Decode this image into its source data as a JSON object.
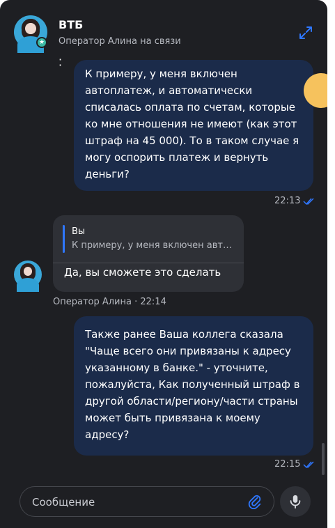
{
  "header": {
    "title": "ВТБ",
    "subtitle": "Оператор Алина на связи",
    "expand_icon": "expand-arrows-icon"
  },
  "messages": [
    {
      "type": "outgoing",
      "text": "К примеру, у меня включен автоплатеж, и автоматически списалась оплата по счетам, которые ко мне отношения не имеют (как этот штраф на 45 000). То в таком случае я могу оспорить платеж и вернуть деньги?",
      "time": "22:13",
      "status": "read"
    },
    {
      "type": "incoming",
      "quote": {
        "author": "Вы",
        "text": "К примеру, у меня включен автоплатеж, и автоматически списалась оплата по счетам"
      },
      "text": "Да, вы сможете это сделать",
      "meta": "Оператор Алина · 22:14"
    },
    {
      "type": "outgoing",
      "text": "Также ранее Ваша коллега сказала \"Чаще всего они привязаны к адресу указанному в банке.\" - уточните, пожалуйста, Как полученный штраф в другой области/региону/части страны может быть привязана к моему адресу?",
      "time": "22:15",
      "status": "read"
    }
  ],
  "composer": {
    "placeholder": "Сообщение",
    "attach_icon": "paperclip-icon",
    "mic_icon": "microphone-icon"
  },
  "colors": {
    "background": "#1e1f23",
    "outgoing_bubble": "#1b2b4a",
    "incoming_bubble": "#2e3036",
    "accent": "#2f77ff",
    "online_badge": "#3bb9a5"
  }
}
